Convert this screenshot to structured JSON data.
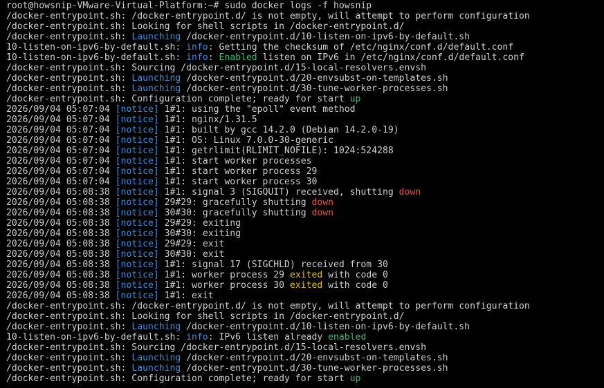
{
  "terminal": {
    "colors": {
      "background": "#000000",
      "text": "#d0d0d0",
      "blue": "#3b8fd9",
      "green": "#2ec27e",
      "red": "#e5534b",
      "yellow": "#e5c100"
    },
    "lines": [
      {
        "segments": [
          {
            "t": "root@howsnip-VMware-Virtual-Platform:~# sudo docker logs -f howsnip"
          }
        ]
      },
      {
        "segments": [
          {
            "t": "/docker-entrypoint.sh: /docker-entrypoint.d/ is not empty, will attempt to perform configuration"
          }
        ]
      },
      {
        "segments": [
          {
            "t": "/docker-entrypoint.sh: Looking for shell scripts in /docker-entrypoint.d/"
          }
        ]
      },
      {
        "segments": [
          {
            "t": "/docker-entrypoint.sh: "
          },
          {
            "t": "Launching",
            "c": "blue"
          },
          {
            "t": " /docker-entrypoint.d/10-listen-on-ipv6-by-default.sh"
          }
        ]
      },
      {
        "segments": [
          {
            "t": "10-listen-on-ipv6-by-default.sh: "
          },
          {
            "t": "info",
            "c": "blue"
          },
          {
            "t": ": Getting the checksum of /etc/nginx/conf.d/default.conf"
          }
        ]
      },
      {
        "segments": [
          {
            "t": "10-listen-on-ipv6-by-default.sh: "
          },
          {
            "t": "info",
            "c": "blue"
          },
          {
            "t": ": "
          },
          {
            "t": "Enabled",
            "c": "green"
          },
          {
            "t": " listen on IPv6 in /etc/nginx/conf.d/default.conf"
          }
        ]
      },
      {
        "segments": [
          {
            "t": "/docker-entrypoint.sh: Sourcing /docker-entrypoint.d/15-local-resolvers.envsh"
          }
        ]
      },
      {
        "segments": [
          {
            "t": "/docker-entrypoint.sh: "
          },
          {
            "t": "Launching",
            "c": "blue"
          },
          {
            "t": " /docker-entrypoint.d/20-envsubst-on-templates.sh"
          }
        ]
      },
      {
        "segments": [
          {
            "t": "/docker-entrypoint.sh: "
          },
          {
            "t": "Launching",
            "c": "blue"
          },
          {
            "t": " /docker-entrypoint.d/30-tune-worker-processes.sh"
          }
        ]
      },
      {
        "segments": [
          {
            "t": "/docker-entrypoint.sh: Configuration complete; ready for start "
          },
          {
            "t": "up",
            "c": "green"
          }
        ]
      },
      {
        "segments": [
          {
            "t": "2026/09/04 05:07:04 "
          },
          {
            "t": "[notice]",
            "c": "blue"
          },
          {
            "t": " 1#1: using the \"epoll\" event method"
          }
        ]
      },
      {
        "segments": [
          {
            "t": "2026/09/04 05:07:04 "
          },
          {
            "t": "[notice]",
            "c": "blue"
          },
          {
            "t": " 1#1: nginx/1.31.5"
          }
        ]
      },
      {
        "segments": [
          {
            "t": "2026/09/04 05:07:04 "
          },
          {
            "t": "[notice]",
            "c": "blue"
          },
          {
            "t": " 1#1: built by gcc 14.2.0 (Debian 14.2.0-19)"
          }
        ]
      },
      {
        "segments": [
          {
            "t": "2026/09/04 05:07:04 "
          },
          {
            "t": "[notice]",
            "c": "blue"
          },
          {
            "t": " 1#1: OS: Linux 7.0.0-30-generic"
          }
        ]
      },
      {
        "segments": [
          {
            "t": "2026/09/04 05:07:04 "
          },
          {
            "t": "[notice]",
            "c": "blue"
          },
          {
            "t": " 1#1: getrlimit(RLIMIT_NOFILE): 1024:524288"
          }
        ]
      },
      {
        "segments": [
          {
            "t": "2026/09/04 05:07:04 "
          },
          {
            "t": "[notice]",
            "c": "blue"
          },
          {
            "t": " 1#1: start worker processes"
          }
        ]
      },
      {
        "segments": [
          {
            "t": "2026/09/04 05:07:04 "
          },
          {
            "t": "[notice]",
            "c": "blue"
          },
          {
            "t": " 1#1: start worker process 29"
          }
        ]
      },
      {
        "segments": [
          {
            "t": "2026/09/04 05:07:04 "
          },
          {
            "t": "[notice]",
            "c": "blue"
          },
          {
            "t": " 1#1: start worker process 30"
          }
        ]
      },
      {
        "segments": [
          {
            "t": "2026/09/04 05:08:38 "
          },
          {
            "t": "[notice]",
            "c": "blue"
          },
          {
            "t": " 1#1: signal 3 (SIGQUIT) received, shutting "
          },
          {
            "t": "down",
            "c": "red"
          }
        ]
      },
      {
        "segments": [
          {
            "t": "2026/09/04 05:08:38 "
          },
          {
            "t": "[notice]",
            "c": "blue"
          },
          {
            "t": " 29#29: gracefully shutting "
          },
          {
            "t": "down",
            "c": "red"
          }
        ]
      },
      {
        "segments": [
          {
            "t": "2026/09/04 05:08:38 "
          },
          {
            "t": "[notice]",
            "c": "blue"
          },
          {
            "t": " 30#30: gracefully shutting "
          },
          {
            "t": "down",
            "c": "red"
          }
        ]
      },
      {
        "segments": [
          {
            "t": "2026/09/04 05:08:38 "
          },
          {
            "t": "[notice]",
            "c": "blue"
          },
          {
            "t": " 29#29: exiting"
          }
        ]
      },
      {
        "segments": [
          {
            "t": "2026/09/04 05:08:38 "
          },
          {
            "t": "[notice]",
            "c": "blue"
          },
          {
            "t": " 30#30: exiting"
          }
        ]
      },
      {
        "segments": [
          {
            "t": "2026/09/04 05:08:38 "
          },
          {
            "t": "[notice]",
            "c": "blue"
          },
          {
            "t": " 29#29: exit"
          }
        ]
      },
      {
        "segments": [
          {
            "t": "2026/09/04 05:08:38 "
          },
          {
            "t": "[notice]",
            "c": "blue"
          },
          {
            "t": " 30#30: exit"
          }
        ]
      },
      {
        "segments": [
          {
            "t": "2026/09/04 05:08:38 "
          },
          {
            "t": "[notice]",
            "c": "blue"
          },
          {
            "t": " 1#1: signal 17 (SIGCHLD) received from 30"
          }
        ]
      },
      {
        "segments": [
          {
            "t": "2026/09/04 05:08:38 "
          },
          {
            "t": "[notice]",
            "c": "blue"
          },
          {
            "t": " 1#1: worker process 29 "
          },
          {
            "t": "exited",
            "c": "yellow"
          },
          {
            "t": " with code 0"
          }
        ]
      },
      {
        "segments": [
          {
            "t": "2026/09/04 05:08:38 "
          },
          {
            "t": "[notice]",
            "c": "blue"
          },
          {
            "t": " 1#1: worker process 30 "
          },
          {
            "t": "exited",
            "c": "yellow"
          },
          {
            "t": " with code 0"
          }
        ]
      },
      {
        "segments": [
          {
            "t": "2026/09/04 05:08:38 "
          },
          {
            "t": "[notice]",
            "c": "blue"
          },
          {
            "t": " 1#1: exit"
          }
        ]
      },
      {
        "segments": [
          {
            "t": "/docker-entrypoint.sh: /docker-entrypoint.d/ is not empty, will attempt to perform configuration"
          }
        ]
      },
      {
        "segments": [
          {
            "t": "/docker-entrypoint.sh: Looking for shell scripts in /docker-entrypoint.d/"
          }
        ]
      },
      {
        "segments": [
          {
            "t": "/docker-entrypoint.sh: "
          },
          {
            "t": "Launching",
            "c": "blue"
          },
          {
            "t": " /docker-entrypoint.d/10-listen-on-ipv6-by-default.sh"
          }
        ]
      },
      {
        "segments": [
          {
            "t": "10-listen-on-ipv6-by-default.sh: "
          },
          {
            "t": "info",
            "c": "blue"
          },
          {
            "t": ": IPv6 listen already "
          },
          {
            "t": "enabled",
            "c": "green"
          }
        ]
      },
      {
        "segments": [
          {
            "t": "/docker-entrypoint.sh: Sourcing /docker-entrypoint.d/15-local-resolvers.envsh"
          }
        ]
      },
      {
        "segments": [
          {
            "t": "/docker-entrypoint.sh: "
          },
          {
            "t": "Launching",
            "c": "blue"
          },
          {
            "t": " /docker-entrypoint.d/20-envsubst-on-templates.sh"
          }
        ]
      },
      {
        "segments": [
          {
            "t": "/docker-entrypoint.sh: "
          },
          {
            "t": "Launching",
            "c": "blue"
          },
          {
            "t": " /docker-entrypoint.d/30-tune-worker-processes.sh"
          }
        ]
      },
      {
        "segments": [
          {
            "t": "/docker-entrypoint.sh: Configuration complete; ready for start "
          },
          {
            "t": "up",
            "c": "green"
          }
        ]
      }
    ]
  }
}
